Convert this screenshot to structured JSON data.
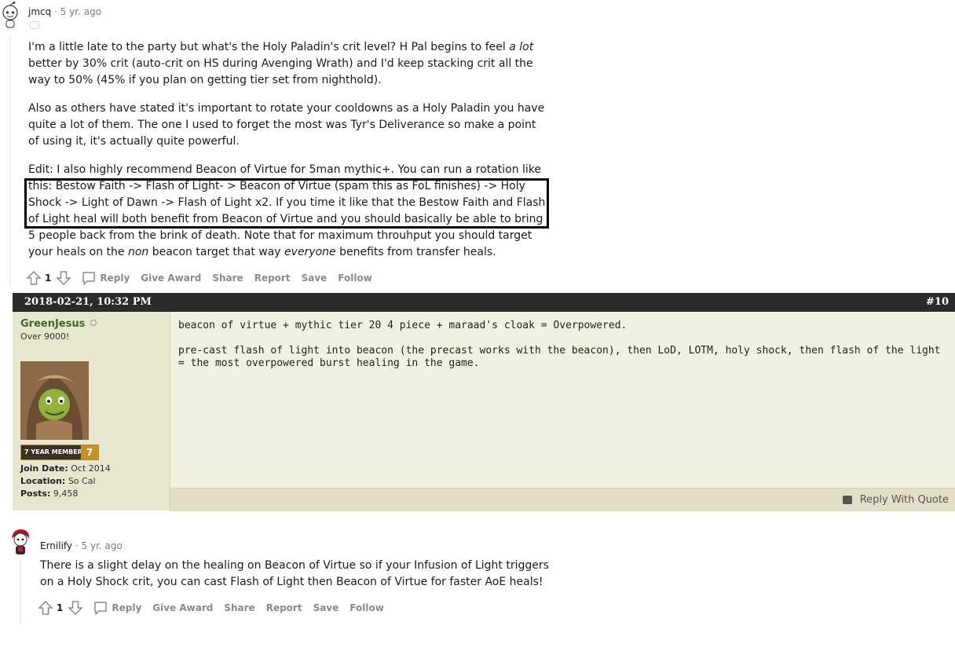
{
  "comment1": {
    "user": "jmcq",
    "age": "5 yr. ago",
    "paragraphs": [
      {
        "parts": [
          {
            "t": "I'm a little late to the party but what's the Holy Paladin's crit level? H Pal begins to feel "
          },
          {
            "t": "a lot",
            "i": true
          },
          {
            "t": " better by 30% crit (auto-crit on HS during Avenging Wrath) and I'd keep stacking crit all the way to 50% (45% if you plan on getting tier set from nighthold)."
          }
        ]
      },
      {
        "parts": [
          {
            "t": "Also as others have stated it's important to rotate your cooldowns as a Holy Paladin you have quite a lot of them. The one I used to forget the most was Tyr's Deliverance so make a point of using it, it's actually quite powerful."
          }
        ]
      },
      {
        "parts": [
          {
            "t": "Edit: I also highly recommend Beacon of Virtue for 5man mythic+. You can run a rotation like this: Bestow Faith -> Flash of Light- > Beacon of Virtue (spam this as FoL finishes) -> Holy Shock -> Light of Dawn -> Flash of Light x2. If you time it like that the Bestow Faith and Flash of Light heal will both benefit from Beacon of Virtue and you should basically be able to bring 5 people back from the brink of death. Note that for maximum throuhput you should target your heals on the "
          },
          {
            "t": "non",
            "i": true
          },
          {
            "t": " beacon target that way "
          },
          {
            "t": "everyone",
            "i": true
          },
          {
            "t": " benefits from transfer heals."
          }
        ]
      }
    ],
    "votes": "1",
    "actions": {
      "reply": "Reply",
      "award": "Give Award",
      "share": "Share",
      "report": "Report",
      "save": "Save",
      "follow": "Follow"
    }
  },
  "forum_post": {
    "date": "2018-02-21, 10:32 PM",
    "post_number": "#10",
    "username": "GreenJesus",
    "user_title": "Over 9000!",
    "badge_label": "7 YEAR MEMBER",
    "badge_years": "7",
    "join_label": "Join Date:",
    "join_value": "Oct 2014",
    "location_label": "Location:",
    "location_value": "So Cal",
    "posts_label": "Posts:",
    "posts_value": "9,458",
    "message_lines": [
      "beacon of virtue + mythic tier 20 4 piece + maraad's cloak = Overpowered.",
      "pre-cast flash of light into beacon (the precast works with the beacon), then LoD, LOTM, holy shock, then flash of the light = the most overpowered burst healing in the game."
    ],
    "reply_with_quote": "Reply With Quote"
  },
  "comment2": {
    "user": "Ernilify",
    "age": "5 yr. ago",
    "body": "There is a slight delay on the healing on Beacon of Virtue so if your Infusion of Light triggers on a Holy Shock crit, you can cast Flash of Light then Beacon of Virtue for faster AoE heals!",
    "votes": "1",
    "actions": {
      "reply": "Reply",
      "award": "Give Award",
      "share": "Share",
      "report": "Report",
      "save": "Save",
      "follow": "Follow"
    }
  },
  "colors": {
    "forum_header": "#2b2b2b",
    "forum_bg": "#f1f0e1",
    "username_green": "#3d6b2a",
    "badge_gold": "#c4912a"
  }
}
